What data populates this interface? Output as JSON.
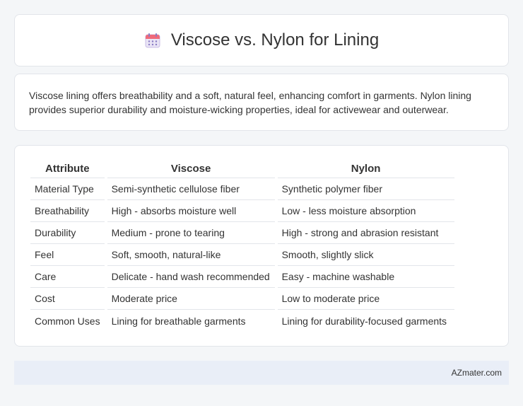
{
  "header": {
    "title": "Viscose vs. Nylon for Lining",
    "icon": "calendar-icon"
  },
  "intro": {
    "text": "Viscose lining offers breathability and a soft, natural feel, enhancing comfort in garments. Nylon lining provides superior durability and moisture-wicking properties, ideal for activewear and outerwear."
  },
  "table": {
    "headers": [
      "Attribute",
      "Viscose",
      "Nylon"
    ],
    "rows": [
      [
        "Material Type",
        "Semi-synthetic cellulose fiber",
        "Synthetic polymer fiber"
      ],
      [
        "Breathability",
        "High - absorbs moisture well",
        "Low - less moisture absorption"
      ],
      [
        "Durability",
        "Medium - prone to tearing",
        "High - strong and abrasion resistant"
      ],
      [
        "Feel",
        "Soft, smooth, natural-like",
        "Smooth, slightly slick"
      ],
      [
        "Care",
        "Delicate - hand wash recommended",
        "Easy - machine washable"
      ],
      [
        "Cost",
        "Moderate price",
        "Low to moderate price"
      ],
      [
        "Common Uses",
        "Lining for breathable garments",
        "Lining for durability-focused garments"
      ]
    ]
  },
  "footer": {
    "text": "AZmater.com"
  }
}
